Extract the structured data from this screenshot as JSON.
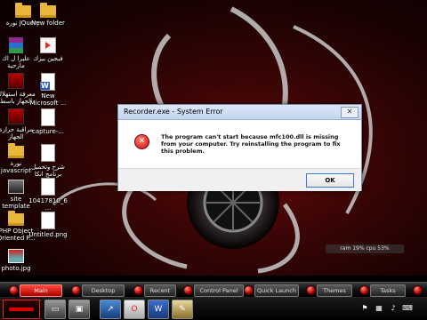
{
  "desktop": {
    "icons": [
      {
        "label": "نورة JQuery",
        "type": "folder"
      },
      {
        "label": "New folder",
        "type": "folder"
      },
      {
        "label": "عليرا ل اك مارحية",
        "type": "rar"
      },
      {
        "label": "فيجين بيزك",
        "type": "media"
      },
      {
        "label": "معرفة استهلاك الجهاز باسط",
        "type": "img-red"
      },
      {
        "label": "New Microsoft ...",
        "type": "doc"
      },
      {
        "label": "مراقبة حرارة الجهاز",
        "type": "img-red"
      },
      {
        "label": "capture-...",
        "type": "doc"
      },
      {
        "label": "نورة javascript",
        "type": "folder"
      },
      {
        "label": "شرح وتحميل برنامج انكا",
        "type": "doc"
      },
      {
        "label": "site template",
        "type": "img-dark"
      },
      {
        "label": "10417810_6...",
        "type": "doc"
      },
      {
        "label": "PHP Object Oriented P...",
        "type": "folder"
      },
      {
        "label": "Untitled.png",
        "type": "doc"
      },
      {
        "label": "photo.jpg",
        "type": "pic"
      }
    ],
    "gadget_text": "ram 19%  cpu 53%"
  },
  "dialog": {
    "title": "Recorder.exe - System Error",
    "close_label": "✕",
    "message": "The program can't start because mfc100.dll is missing from your computer. Try reinstalling the program to fix this problem.",
    "ok_label": "OK",
    "accent_color": "#3a7bd5"
  },
  "taskbar": {
    "tabs": [
      "Main",
      "Desktop",
      "Recent",
      "Control Panel",
      "Quick Launch",
      "Themes",
      "Tasks"
    ],
    "task_icons": [
      {
        "name": "desktop-icon",
        "glyph": "▭"
      },
      {
        "name": "monitor-icon",
        "glyph": "▣"
      },
      {
        "name": "arrow-icon",
        "glyph": "↗"
      },
      {
        "name": "opera-icon",
        "glyph": "O"
      },
      {
        "name": "word-icon",
        "glyph": "W"
      },
      {
        "name": "paint-icon",
        "glyph": "✎"
      }
    ],
    "tray_icons": [
      {
        "name": "tray-flag-icon",
        "glyph": "⚑"
      },
      {
        "name": "tray-network-icon",
        "glyph": "▦"
      },
      {
        "name": "tray-volume-icon",
        "glyph": "♪"
      },
      {
        "name": "tray-keyboard-icon",
        "glyph": "⌨"
      }
    ]
  }
}
